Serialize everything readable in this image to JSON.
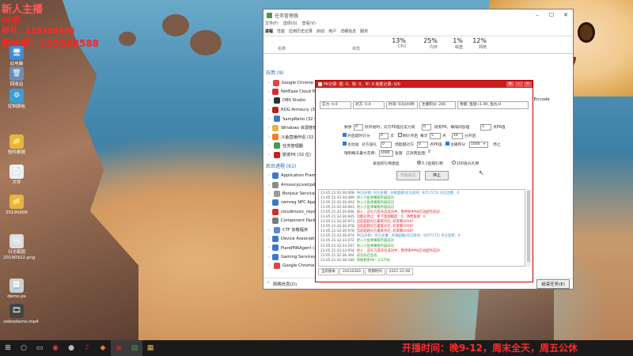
{
  "overlay": {
    "line1": "新人主播",
    "line2": "QQ群",
    "line3": "群号：119388588",
    "line4": "粉丝群：119388588"
  },
  "desktop_icons": [
    {
      "label": "此电脑",
      "icon": "computer-icon",
      "color": "#3c8dde"
    },
    {
      "label": "回收站",
      "icon": "recycle-bin-icon",
      "color": "#6b8fb5"
    },
    {
      "label": "控制面板",
      "icon": "control-panel-icon",
      "color": "#3aa0d8"
    },
    {
      "label": "软件数据",
      "icon": "folder-icon",
      "color": "#e9b43d"
    },
    {
      "label": "文件",
      "icon": "document-icon",
      "color": "#efefef"
    },
    {
      "label": "20190606",
      "icon": "folder-icon",
      "color": "#e9b43d"
    },
    {
      "label": "日志截图20190922.png",
      "icon": "image-icon",
      "color": "#dcdcdc"
    },
    {
      "label": "demo.ps",
      "icon": "script-icon",
      "color": "#cfcfcf"
    },
    {
      "label": "videodemo.mp4",
      "icon": "video-icon",
      "color": "#444444"
    }
  ],
  "task_manager": {
    "title": "任务管理器",
    "menu": [
      "文件(F)",
      "选项(O)",
      "查看(V)"
    ],
    "tabs": [
      "进程",
      "性能",
      "应用历史记录",
      "启动",
      "用户",
      "详细信息",
      "服务"
    ],
    "active_tab": "进程",
    "columns": {
      "name": "名称",
      "status": "状态"
    },
    "stats": [
      {
        "pct": "13%",
        "label": "CPU"
      },
      {
        "pct": "25%",
        "label": "内存"
      },
      {
        "pct": "1%",
        "label": "磁盘"
      },
      {
        "pct": "12%",
        "label": "网络"
      }
    ],
    "apps_group": "应用 (9)",
    "apps": [
      {
        "name": "Google Chrome (4)",
        "color": "#e4443b"
      },
      {
        "name": "NetEase Cloud Music",
        "color": "#d62b2b"
      },
      {
        "name": "OBS Studio",
        "color": "#303030"
      },
      {
        "name": "ROG Armoury (32 位)",
        "color": "#b81c1c"
      },
      {
        "name": "SampRatio (32 位)",
        "color": "#3c78c8"
      },
      {
        "name": "Windows 资源管理器",
        "color": "#e9b43d"
      },
      {
        "name": "斗鱼直播伴侣 (32 位)",
        "color": "#ff7a1a"
      },
      {
        "name": "任务管理器",
        "color": "#4c9a4c"
      },
      {
        "name": "斯皮PK (32 位)",
        "color": "#c81e1e"
      }
    ],
    "background_group": "后台进程 (61)",
    "background": [
      {
        "name": "Application Frame Host",
        "color": "#3c78c8"
      },
      {
        "name": "ArmouryLiveUpdate",
        "color": "#8a8a8a"
      },
      {
        "name": "Bonjour Service",
        "color": "#9a9a9a"
      },
      {
        "name": "cemreg NFC Application",
        "color": "#3c78c8"
      },
      {
        "name": "cloudmusic_reporter",
        "color": "#d62b2b"
      },
      {
        "name": "Component Package Sup",
        "color": "#7a7a7a"
      },
      {
        "name": "CTF 加载程序",
        "color": "#5a8ad2"
      },
      {
        "name": "Device Association Fra",
        "color": "#3c78c8"
      },
      {
        "name": "FlarePNKAgent (32 位)",
        "color": "#3c78c8"
      },
      {
        "name": "Gaming Services (2)",
        "color": "#3c78c8"
      },
      {
        "name": "Google Chrome",
        "color": "#e4443b"
      }
    ],
    "tail_text": "eo Encode",
    "footer_less": "简略信息(D)",
    "footer_end_task": "结束任务(E)"
  },
  "pk_window": {
    "title": "PK记录: 胜: 0、败: 0、平: 0  连胜记录: 0/0",
    "stats": [
      "实力: 0.0",
      "对方: 0.0",
      "时间: 03分40秒",
      "主播积分: 206",
      "余额: 鱼翅+1.00, 鱼丸:0"
    ],
    "form": {
      "remaining_label": "剩余",
      "remaining_value": "0",
      "after_label": "秒开始时，对方PK值比实力高",
      "after_value": "0",
      "finish_label": "就有PK，每隔间加值",
      "finish_value": "5",
      "finish_suffix": "点PK值",
      "auto_tally": "开启超时计分",
      "tally_value": "0",
      "tally_unit": "次",
      "countdown": "倒计开启",
      "delta_label": "每次",
      "delta_value": "5",
      "delta_unit": "点",
      "target_value": "10",
      "target_unit": "分开启",
      "auto_give": "主动送",
      "opponent_label": "对方送礼",
      "opponent_value": "0",
      "threshold_label": "场超越对方",
      "threshold_value": "0",
      "threshold_unit": "点PK值",
      "host_points": "主播积分",
      "host_points_value": "1000",
      "stop_label": "停止",
      "limit_label": "限制每天最大花费：",
      "limit_value": "1000",
      "limit_unit": "鱼翅",
      "spent_label": "已消费鱼翅：",
      "spent_value": "0",
      "gift_label": "发送的礼物类型",
      "gift_option_1": "0.1鱼翅礼物",
      "gift_option_2": "100鱼丸礼物",
      "start_btn": "开始执行",
      "stop_btn": "停止"
    },
    "log": [
      {
        "time": "11-05 21:32:30.008",
        "text": "PK已开始: 对方主播：升级超级(对方房间：9257172) 对方连胜：0",
        "color": "#2f8fc9"
      },
      {
        "time": "11-05 21:32:30.489",
        "text": "进入小鱼弹幕服务器成功",
        "color": "#2e9e2e"
      },
      {
        "time": "11-05 21:32:30.493",
        "text": "进入小鱼弹幕服务器成功",
        "color": "#2e9e2e"
      },
      {
        "time": "11-05 21:32:30.663",
        "text": "进入小鱼弹幕服务器成功",
        "color": "#2e9e2e"
      },
      {
        "time": "11-05 21:32:30.694",
        "text": "进入：这礼只是开启成功中，暂停保中PK启动超时成功!",
        "color": "#e0262d"
      },
      {
        "time": "11-05 21:32:30.945",
        "text": "功能已停止：余下鱼翅额度：0，消费鱼翅：0",
        "color": "#e0262d"
      },
      {
        "time": "11-05 21:32:30.973",
        "text": "当前超越对方最来开启, 结束算2058?",
        "color": "#e0262d"
      },
      {
        "time": "11-05 21:32:30.978",
        "text": "当前超越对方最来开启, 结束算2058?",
        "color": "#e0262d"
      },
      {
        "time": "11-05 21:32:30.978",
        "text": "当前超越对方最来开启, 结束算2058?",
        "color": "#e0262d"
      },
      {
        "time": "11-05 21:32:30.974",
        "text": "PK已开始：对方主播：升级超级(对方房间：9257172) 对方连胜：0",
        "color": "#2f8fc9"
      },
      {
        "time": "11-05 21:32:33.072",
        "text": "进入小鱼弹幕服务器成功",
        "color": "#2e9e2e"
      },
      {
        "time": "11-05 21:32:33.597",
        "text": "进入小鱼弹幕服务器成功",
        "color": "#2e9e2e"
      },
      {
        "time": "11-05 21:32:33.954",
        "text": "进入：这礼只是开启成功中，暂停保中PK启动超时成功!",
        "color": "#e0262d"
      },
      {
        "time": "11-05 21:32:36.364",
        "text": "成功开启生成",
        "color": "#2e9e2e"
      },
      {
        "time": "11-05 21:32:38.180",
        "text": "周报剩余PK：2/3708",
        "color": "#2e9e2e"
      }
    ],
    "status": [
      "当前版本",
      "20210320",
      "到期时间",
      "2021-12-08"
    ]
  },
  "taskbar": {
    "icons": [
      "windows-start-icon",
      "search-icon",
      "task-view-icon",
      "chrome-icon",
      "obs-icon",
      "music-icon",
      "douyu-icon",
      "pk-app-icon",
      "taskmgr-icon",
      "explorer-icon"
    ]
  },
  "marquee": "开播时间：晚9-12，周末全天，周五公休"
}
